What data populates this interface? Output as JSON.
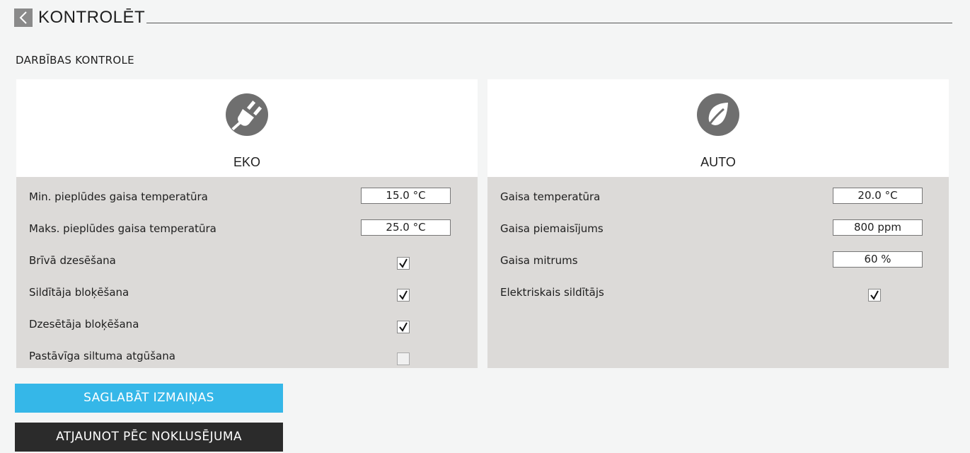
{
  "header": {
    "title": "KONTROLĒT"
  },
  "section": {
    "title": "DARBĪBAS KONTROLE"
  },
  "eko": {
    "label": "EKO",
    "rows": [
      {
        "label": "Min. pieplūdes gaisa temperatūra",
        "value": "15.0  °C"
      },
      {
        "label": "Maks. pieplūdes gaisa temperatūra",
        "value": "25.0 °C"
      },
      {
        "label": "Brīvā dzesēšana",
        "checked": true
      },
      {
        "label": "Sildītāja bloķēšana",
        "checked": true
      },
      {
        "label": "Dzesētāja bloķēšana",
        "checked": true
      },
      {
        "label": "Pastāvīga siltuma atgūšana",
        "checked": false
      }
    ]
  },
  "auto": {
    "label": "AUTO",
    "rows": [
      {
        "label": "Gaisa temperatūra",
        "value": "20.0  °C"
      },
      {
        "label": "Gaisa piemaisījums",
        "value": "800 ppm"
      },
      {
        "label": "Gaisa mitrums",
        "value": "60 %"
      },
      {
        "label": "Elektriskais sildītājs",
        "checked": true
      }
    ]
  },
  "buttons": {
    "save": "SAGLABĀT IZMAIŅAS",
    "reset": "ATJAUNOT PĒC NOKLUSĒJUMA"
  },
  "icons": {
    "back": "chevron-left-icon",
    "eko": "plug-icon",
    "auto": "leaf-icon"
  },
  "colors": {
    "save_button": "#35b7e8",
    "reset_button": "#2b2b2b",
    "panel_body": "#dcdad8",
    "icon": "#6f6f6f"
  }
}
